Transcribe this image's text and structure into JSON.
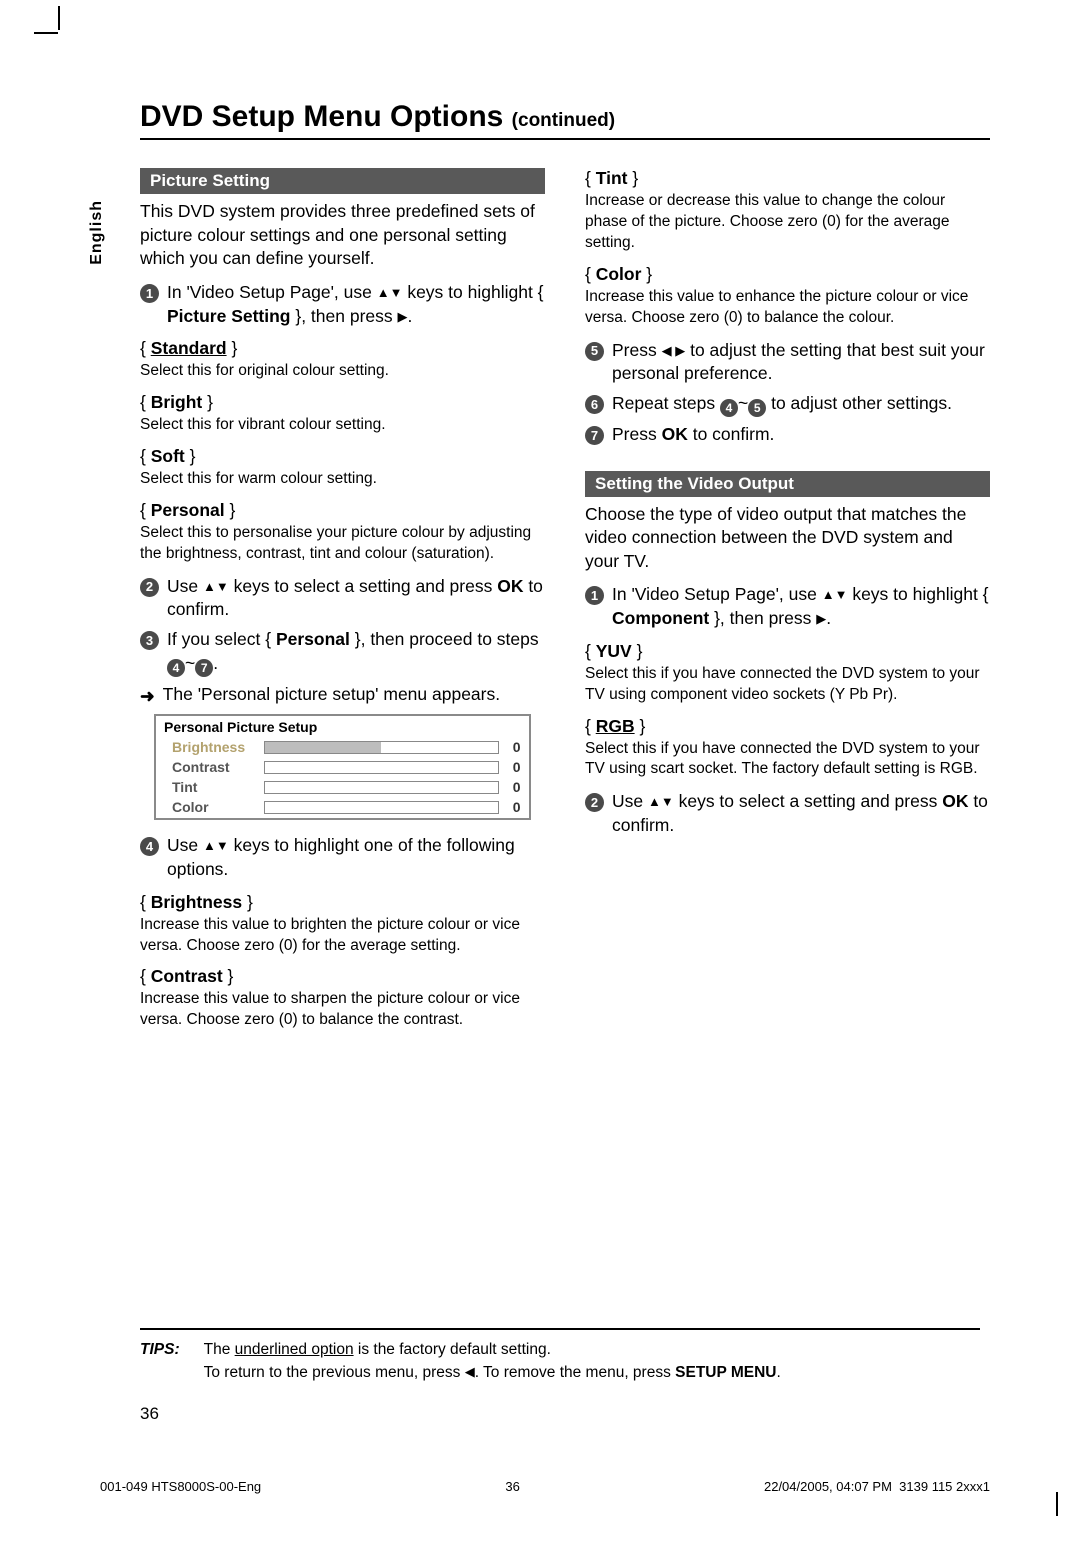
{
  "lang_tab": "English",
  "title": "DVD Setup Menu Options",
  "title_cont": "(continued)",
  "left": {
    "section": "Picture Setting",
    "intro": "This DVD system provides three predefined sets of picture colour settings and one personal setting which you can define yourself.",
    "step1_a": "In 'Video Setup Page', use ",
    "step1_b": " keys to highlight { ",
    "step1_bold": "Picture Setting",
    "step1_c": " }, then press ",
    "step1_d": ".",
    "opt_standard": "Standard",
    "opt_standard_desc": "Select this for original colour setting.",
    "opt_bright": "Bright",
    "opt_bright_desc": "Select this for vibrant colour setting.",
    "opt_soft": "Soft",
    "opt_soft_desc": "Select this for warm colour setting.",
    "opt_personal": "Personal",
    "opt_personal_desc": "Select this to personalise your picture colour by adjusting the brightness, contrast, tint and colour (saturation).",
    "step2_a": "Use ",
    "step2_b": " keys to select a setting and press ",
    "step2_bold": "OK",
    "step2_c": " to confirm.",
    "step3_a": "If you select { ",
    "step3_bold": "Personal",
    "step3_b": " }, then proceed to steps ",
    "step3_c": "~",
    "step3_d": ".",
    "arrow_line": "The 'Personal picture setup' menu appears.",
    "pps": {
      "title": "Personal Picture Setup",
      "rows": [
        {
          "name": "Brightness",
          "val": "0",
          "sel": true
        },
        {
          "name": "Contrast",
          "val": "0",
          "sel": false
        },
        {
          "name": "Tint",
          "val": "0",
          "sel": false
        },
        {
          "name": "Color",
          "val": "0",
          "sel": false
        }
      ]
    },
    "step4_a": "Use ",
    "step4_b": " keys to highlight one of the following options.",
    "opt_brightness": "Brightness",
    "opt_brightness_desc": "Increase this value to brighten the picture colour or vice versa. Choose zero (0) for the average setting.",
    "opt_contrast": "Contrast",
    "opt_contrast_desc": "Increase this value to sharpen the picture colour or vice versa.  Choose zero (0) to balance the contrast."
  },
  "right": {
    "opt_tint": "Tint",
    "opt_tint_desc": "Increase or decrease this value to change the colour phase of the picture.  Choose zero (0) for the average setting.",
    "opt_color": "Color",
    "opt_color_desc": "Increase this value to enhance the picture colour or vice versa. Choose zero (0) to balance the colour.",
    "step5_a": "Press ",
    "step5_b": " to adjust the setting that best suit your personal preference.",
    "step6_a": "Repeat steps ",
    "step6_b": "~",
    "step6_c": " to adjust other settings.",
    "step7_a": "Press ",
    "step7_bold": "OK",
    "step7_b": " to confirm.",
    "section2": "Setting the Video Output",
    "intro2": "Choose the type of video output that matches the video connection between the DVD system and your TV.",
    "vstep1_a": "In 'Video Setup Page', use ",
    "vstep1_b": " keys to highlight { ",
    "vstep1_bold": "Component",
    "vstep1_c": " }, then press ",
    "vstep1_d": ".",
    "opt_yuv": "YUV",
    "opt_yuv_desc": "Select this if you have connected the DVD system to your TV using component video sockets (Y Pb Pr).",
    "opt_rgb": "RGB",
    "opt_rgb_desc": "Select this if you have connected the DVD system to your TV using scart socket. The factory default setting is RGB.",
    "vstep2_a": "Use ",
    "vstep2_b": " keys to select a setting and press ",
    "vstep2_bold": "OK",
    "vstep2_c": " to confirm."
  },
  "tips": {
    "label": "TIPS:",
    "line1_a": "The ",
    "line1_u": "underlined option",
    "line1_b": " is the factory default setting.",
    "line2_a": "To return to the previous menu, press ",
    "line2_b": ".  To remove the menu, press ",
    "line2_bold": "SETUP MENU",
    "line2_c": "."
  },
  "page_number": "36",
  "footer": {
    "left": "001-049 HTS8000S-00-Eng",
    "center": "36",
    "right_a": "22/04/2005, 04:07 PM",
    "right_b": "3139 115 2xxx1"
  }
}
